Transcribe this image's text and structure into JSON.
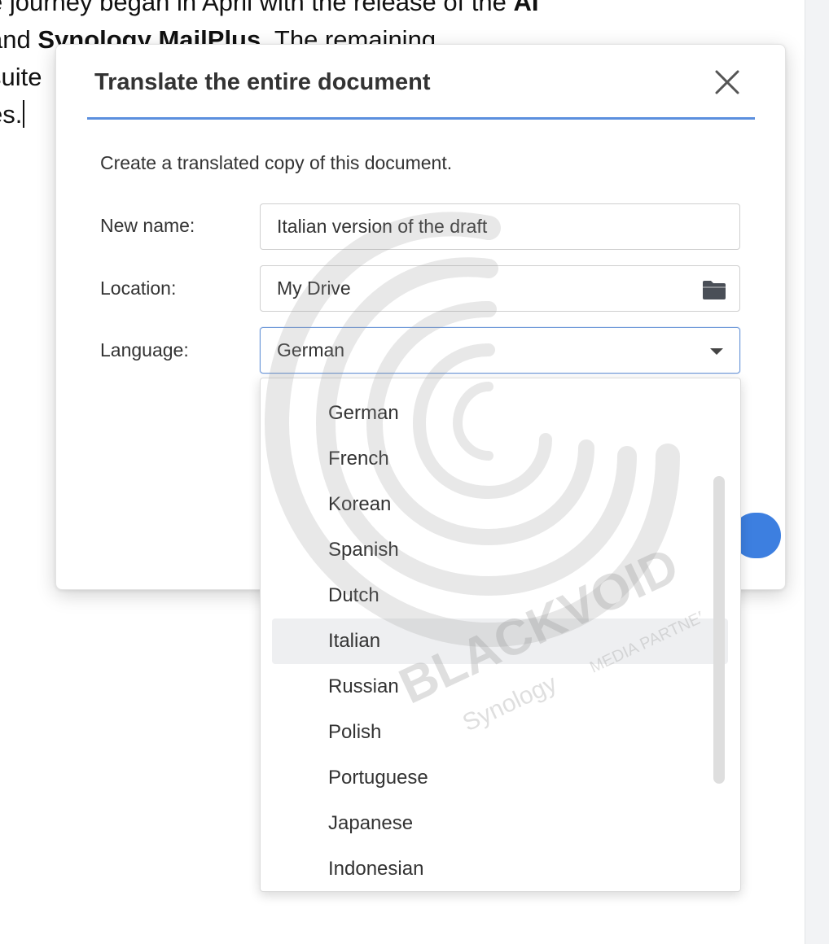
{
  "document": {
    "line1_a": "e journey began in April with the release of the ",
    "line1_b": "AI",
    "line2_a": " and ",
    "line2_b": "Synology MailPlus",
    "line2_c": ". The remaining",
    "line3": "suite",
    "line4": "es."
  },
  "dialog": {
    "title": "Translate the entire document",
    "description": "Create a translated copy of this document.",
    "name_label": "New name:",
    "name_value": "Italian version of the draft",
    "location_label": "Location:",
    "location_value": "My Drive",
    "language_label": "Language:",
    "language_value": "German"
  },
  "dropdown": {
    "options": [
      "German",
      "French",
      "Korean",
      "Spanish",
      "Dutch",
      "Italian",
      "Russian",
      "Polish",
      "Portuguese",
      "Japanese",
      "Indonesian"
    ],
    "hovered": "Italian"
  },
  "watermark": {
    "brand": "BLACKVOID",
    "sub": "Synology",
    "tag": "MEDIA PARTNER"
  },
  "colors": {
    "accent": "#5b8fde",
    "primary_button": "#3d7fe0",
    "hover_row": "#eeeff1"
  },
  "icons": {
    "close": "close-icon",
    "location": "folder-icon",
    "language": "chevron-down-icon"
  }
}
